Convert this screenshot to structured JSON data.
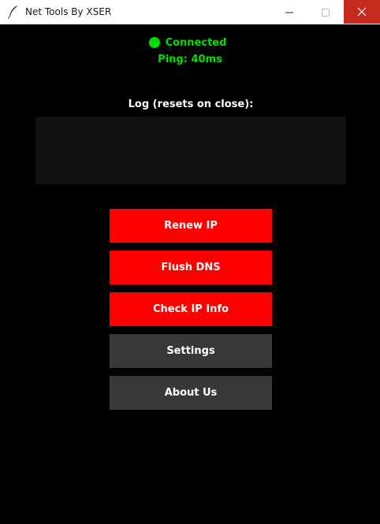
{
  "window": {
    "title": "Net Tools By XSER",
    "icon": "feather-icon",
    "controls": {
      "minimize_icon": "minimize-icon",
      "maximize_icon": "maximize-icon",
      "close_icon": "close-icon",
      "close_hover_color": "#c42b1c"
    }
  },
  "status": {
    "text": "Connected",
    "indicator_color": "#00e000",
    "ping_label": "Ping: 40ms"
  },
  "log": {
    "label": "Log (resets on close):",
    "content": ""
  },
  "buttons": {
    "renew_ip": "Renew IP",
    "flush_dns": "Flush DNS",
    "check_ip_info": "Check IP Info",
    "settings": "Settings",
    "about_us": "About Us"
  },
  "colors": {
    "background": "#000000",
    "primary_button": "#ff0000",
    "secondary_button": "#383838",
    "log_background": "#111111",
    "status_green": "#00e000"
  }
}
